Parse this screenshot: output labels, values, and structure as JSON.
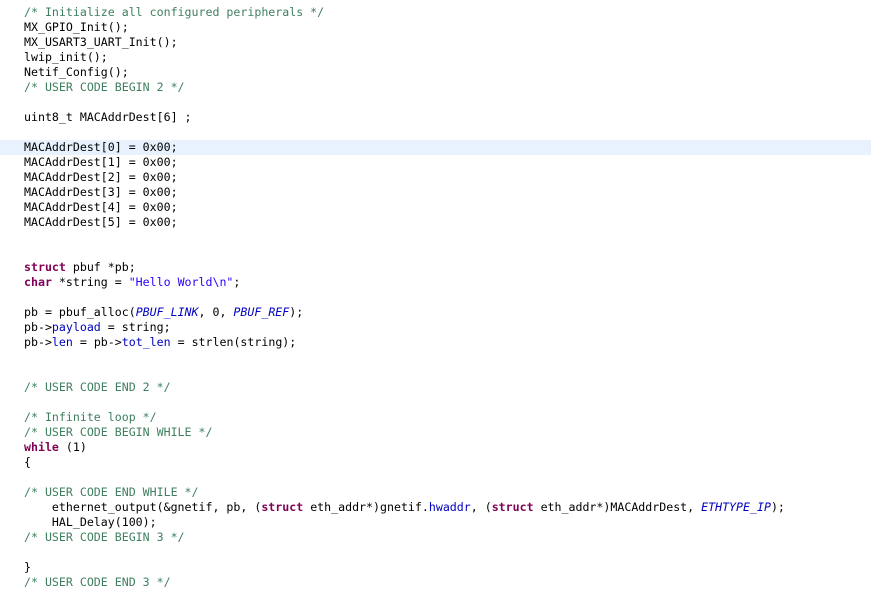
{
  "editor": {
    "current_line": 9,
    "colors": {
      "background": "#ffffff",
      "current_line": "#e8f2fe",
      "comment": "#3f7f5f",
      "keyword": "#7f0055",
      "string": "#2a00ff",
      "field": "#0000c0",
      "macro": "#0000c0",
      "plain": "#000000"
    },
    "lines": [
      [
        {
          "t": "comment",
          "v": "/* Initialize all configured peripherals */"
        }
      ],
      [
        {
          "t": "plain",
          "v": "MX_GPIO_Init();"
        }
      ],
      [
        {
          "t": "plain",
          "v": "MX_USART3_UART_Init();"
        }
      ],
      [
        {
          "t": "plain",
          "v": "lwip_init();"
        }
      ],
      [
        {
          "t": "plain",
          "v": "Netif_Config();"
        }
      ],
      [
        {
          "t": "comment",
          "v": "/* USER CODE BEGIN 2 */"
        }
      ],
      [],
      [
        {
          "t": "plain",
          "v": "uint8_t MACAddrDest[6] ;"
        }
      ],
      [],
      [
        {
          "t": "plain",
          "v": "MACAddrDest[0] = 0x00;"
        }
      ],
      [
        {
          "t": "plain",
          "v": "MACAddrDest[1] = 0x00;"
        }
      ],
      [
        {
          "t": "plain",
          "v": "MACAddrDest[2] = 0x00;"
        }
      ],
      [
        {
          "t": "plain",
          "v": "MACAddrDest[3] = 0x00;"
        }
      ],
      [
        {
          "t": "plain",
          "v": "MACAddrDest[4] = 0x00;"
        }
      ],
      [
        {
          "t": "plain",
          "v": "MACAddrDest[5] = 0x00;"
        }
      ],
      [],
      [],
      [
        {
          "t": "keyword",
          "v": "struct"
        },
        {
          "t": "plain",
          "v": " pbuf *pb;"
        }
      ],
      [
        {
          "t": "keyword",
          "v": "char"
        },
        {
          "t": "plain",
          "v": " *string = "
        },
        {
          "t": "string",
          "v": "\"Hello World\\n\""
        },
        {
          "t": "plain",
          "v": ";"
        }
      ],
      [],
      [
        {
          "t": "plain",
          "v": "pb = pbuf_alloc("
        },
        {
          "t": "macro",
          "v": "PBUF_LINK"
        },
        {
          "t": "plain",
          "v": ", 0, "
        },
        {
          "t": "macro",
          "v": "PBUF_REF"
        },
        {
          "t": "plain",
          "v": ");"
        }
      ],
      [
        {
          "t": "plain",
          "v": "pb->"
        },
        {
          "t": "field",
          "v": "payload"
        },
        {
          "t": "plain",
          "v": " = string;"
        }
      ],
      [
        {
          "t": "plain",
          "v": "pb->"
        },
        {
          "t": "field",
          "v": "len"
        },
        {
          "t": "plain",
          "v": " = pb->"
        },
        {
          "t": "field",
          "v": "tot_len"
        },
        {
          "t": "plain",
          "v": " = strlen(string);"
        }
      ],
      [],
      [],
      [
        {
          "t": "comment",
          "v": "/* USER CODE END 2 */"
        }
      ],
      [],
      [
        {
          "t": "comment",
          "v": "/* Infinite loop */"
        }
      ],
      [
        {
          "t": "comment",
          "v": "/* USER CODE BEGIN WHILE */"
        }
      ],
      [
        {
          "t": "keyword",
          "v": "while"
        },
        {
          "t": "plain",
          "v": " (1)"
        }
      ],
      [
        {
          "t": "plain",
          "v": "{"
        }
      ],
      [],
      [
        {
          "t": "comment",
          "v": "/* USER CODE END WHILE */"
        }
      ],
      [
        {
          "t": "plain",
          "v": "    ethernet_output(&gnetif, pb, ("
        },
        {
          "t": "keyword",
          "v": "struct"
        },
        {
          "t": "plain",
          "v": " eth_addr*)gnetif."
        },
        {
          "t": "field",
          "v": "hwaddr"
        },
        {
          "t": "plain",
          "v": ", ("
        },
        {
          "t": "keyword",
          "v": "struct"
        },
        {
          "t": "plain",
          "v": " eth_addr*)MACAddrDest, "
        },
        {
          "t": "macro",
          "v": "ETHTYPE_IP"
        },
        {
          "t": "plain",
          "v": ");"
        }
      ],
      [
        {
          "t": "plain",
          "v": "    HAL_Delay(100);"
        }
      ],
      [
        {
          "t": "comment",
          "v": "/* USER CODE BEGIN 3 */"
        }
      ],
      [],
      [
        {
          "t": "plain",
          "v": "}"
        }
      ],
      [
        {
          "t": "comment",
          "v": "/* USER CODE END 3 */"
        }
      ]
    ]
  }
}
